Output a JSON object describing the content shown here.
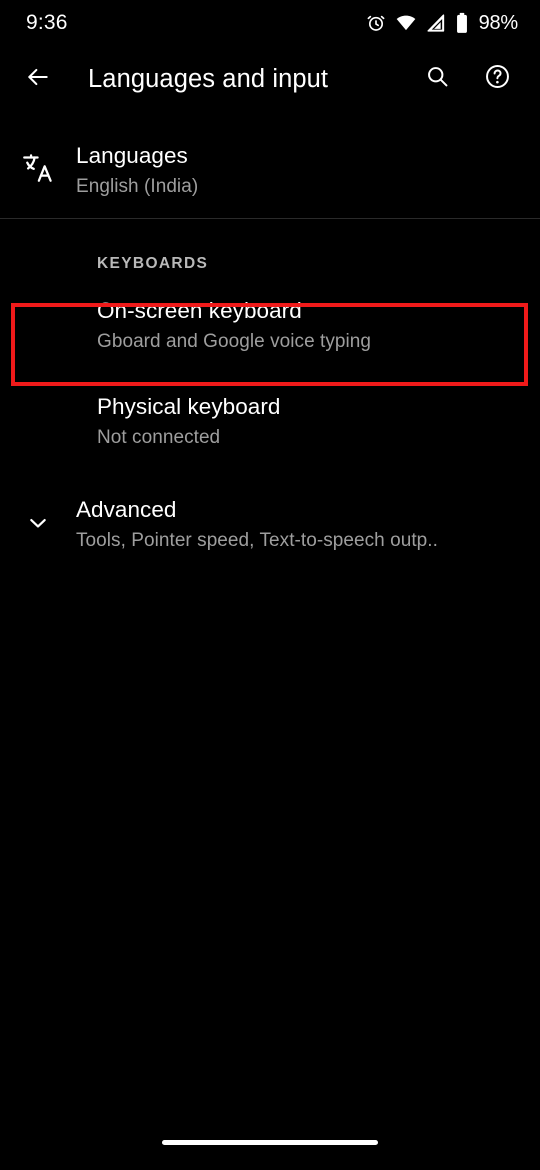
{
  "status_bar": {
    "time": "9:36",
    "battery_percent": "98%",
    "icons": [
      "alarm-clock-icon",
      "wifi-icon",
      "signal-icon",
      "battery-icon"
    ]
  },
  "app_bar": {
    "back_icon": "back-arrow-icon",
    "title": "Languages and input",
    "search_icon": "search-icon",
    "help_icon": "help-circle-icon"
  },
  "list": {
    "languages": {
      "icon": "translate-icon",
      "title": "Languages",
      "subtitle": "English (India)"
    },
    "keyboards_header": "KEYBOARDS",
    "on_screen_keyboard": {
      "title": "On-screen keyboard",
      "subtitle": "Gboard and Google voice typing"
    },
    "physical_keyboard": {
      "title": "Physical keyboard",
      "subtitle": "Not connected"
    },
    "advanced": {
      "icon": "chevron-down-icon",
      "title": "Advanced",
      "subtitle": "Tools, Pointer speed, Text-to-speech outp.."
    }
  },
  "annotation": {
    "highlight_color": "#f01a1a",
    "target": "on-screen-keyboard-row"
  },
  "nav_bar": {
    "home_indicator": "home-indicator"
  },
  "theme": {
    "background": "#000000",
    "primary_text": "#ffffff",
    "secondary_text": "#9e9e9e",
    "divider": "#2a2a2a"
  }
}
